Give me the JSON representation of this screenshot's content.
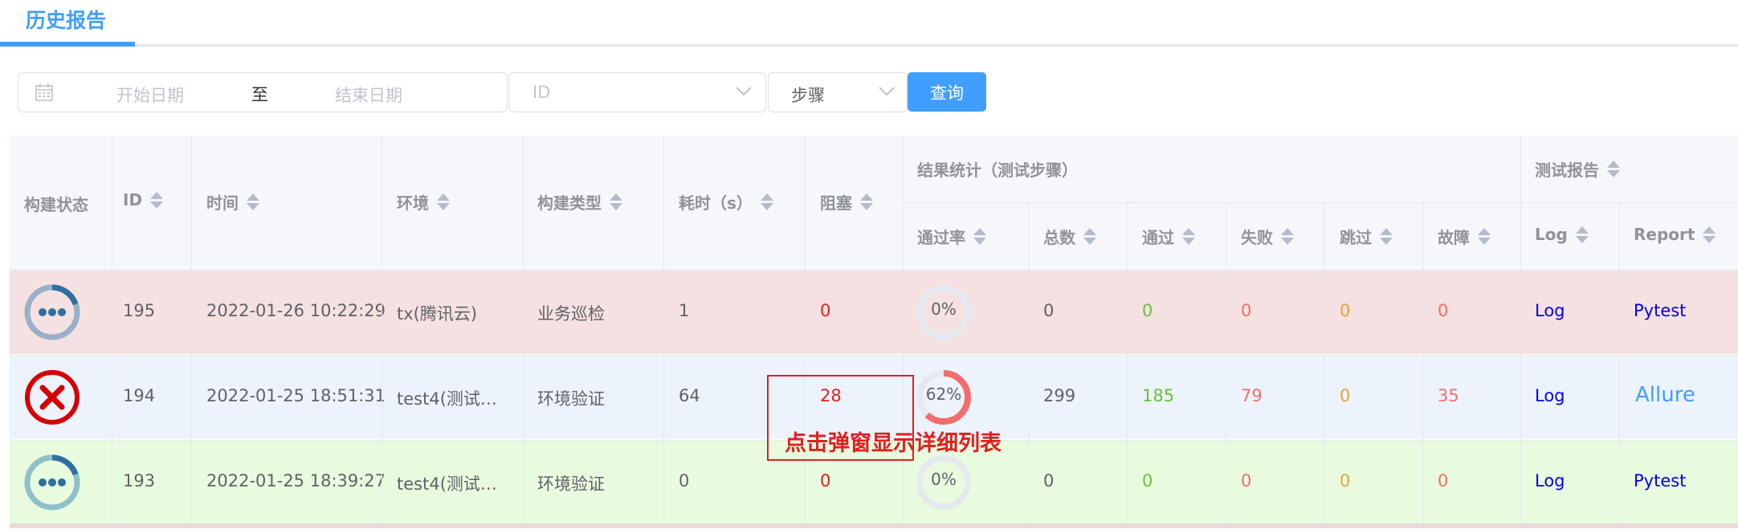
{
  "tab": {
    "label": "历史报告"
  },
  "filters": {
    "start_placeholder": "开始日期",
    "separator": "至",
    "end_placeholder": "结束日期",
    "id_placeholder": "ID",
    "step_value": "步骤",
    "query_label": "查询"
  },
  "table": {
    "headers": {
      "status": "构建状态",
      "id": "ID",
      "time": "时间",
      "env": "环境",
      "build_type": "构建类型",
      "duration": "耗时（s）",
      "blocked": "阻塞",
      "result_group": "结果统计（测试步骤）",
      "pass_rate": "通过率",
      "total": "总数",
      "passed": "通过",
      "failed": "失败",
      "skipped": "跳过",
      "broken": "故障",
      "report_group": "测试报告",
      "log": "Log",
      "report": "Report"
    },
    "rows": [
      {
        "status": "running",
        "id": "195",
        "time": "2022-01-26 10:22:29",
        "env": "tx(腾讯云)",
        "build_type": "业务巡检",
        "duration": "1",
        "blocked": "0",
        "pass_rate": "0%",
        "pass_rate_value": 0,
        "total": "0",
        "passed": "0",
        "failed": "0",
        "skipped": "0",
        "broken": "0",
        "log": "Log",
        "report": "Pytest"
      },
      {
        "status": "failed",
        "id": "194",
        "time": "2022-01-25 18:51:31",
        "env": "test4(测试…",
        "build_type": "环境验证",
        "duration": "64",
        "blocked": "28",
        "pass_rate": "62%",
        "pass_rate_value": 0.62,
        "total": "299",
        "passed": "185",
        "failed": "79",
        "skipped": "0",
        "broken": "35",
        "log": "Log",
        "report": "Allure"
      },
      {
        "status": "running",
        "id": "193",
        "time": "2022-01-25 18:39:27",
        "env": "test4(测试…",
        "build_type": "环境验证",
        "duration": "0",
        "blocked": "0",
        "pass_rate": "0%",
        "pass_rate_value": 0,
        "total": "0",
        "passed": "0",
        "failed": "0",
        "skipped": "0",
        "broken": "0",
        "log": "Log",
        "report": "Pytest"
      }
    ]
  },
  "annotation": {
    "text": "点击弹窗显示详细列表"
  },
  "colors": {
    "accent": "#409eff",
    "passed": "#67c23a",
    "failed": "#f56c6c",
    "skipped": "#e6a23c",
    "blocked": "#e02020"
  }
}
